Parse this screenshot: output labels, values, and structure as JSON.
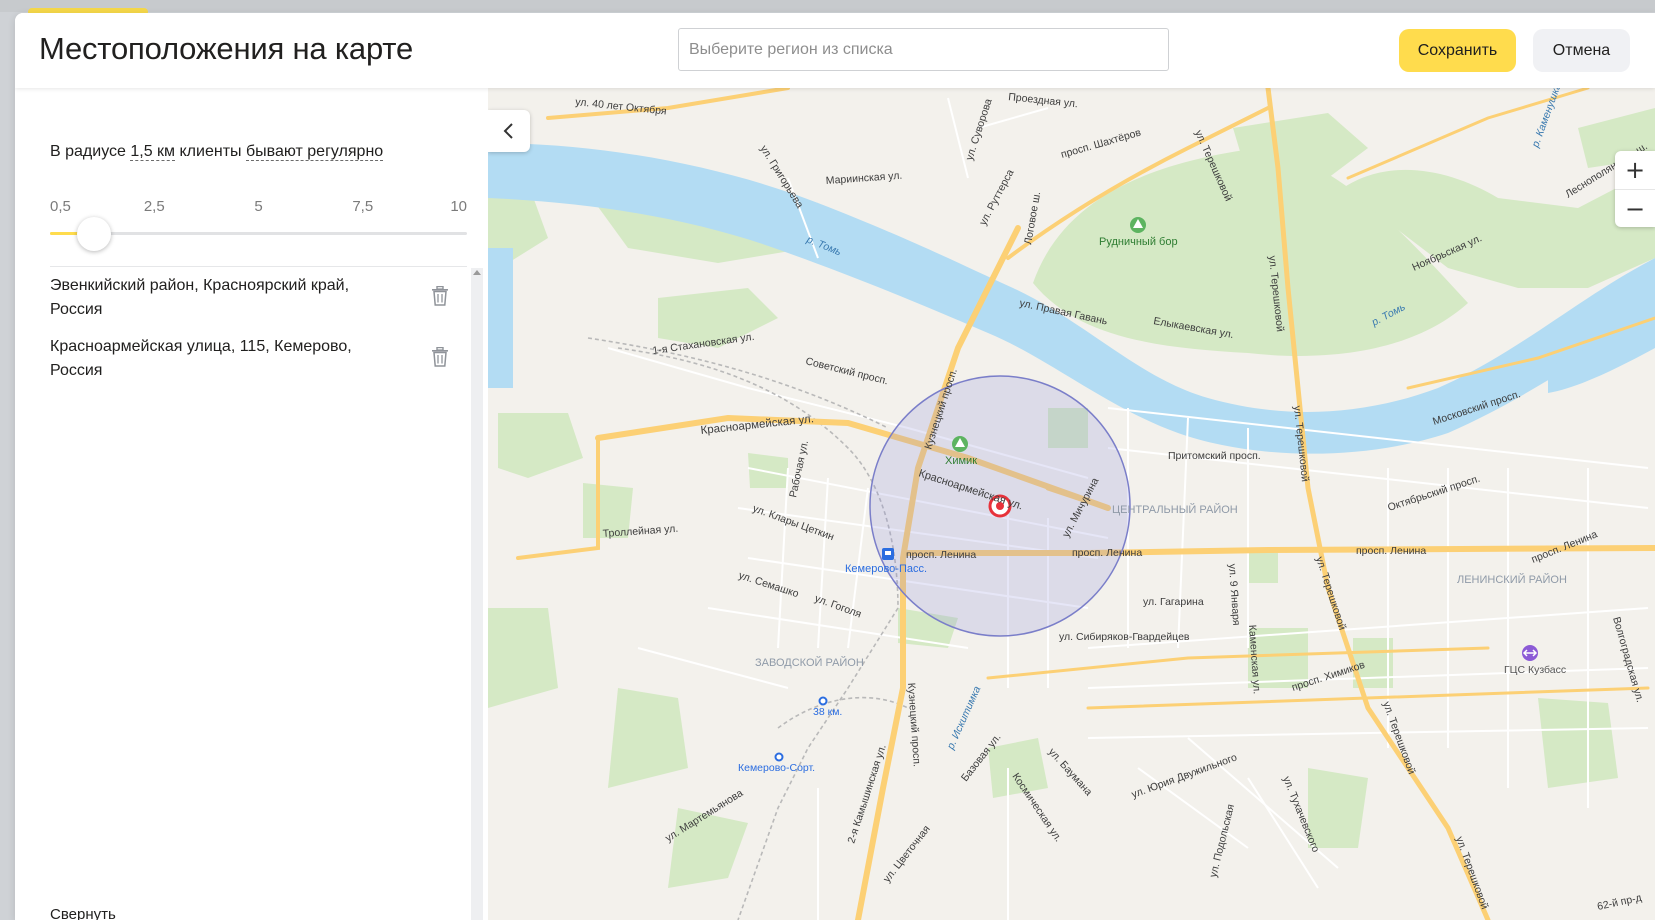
{
  "header": {
    "title": "Местоположения на карте",
    "region_placeholder": "Выберите регион из списка",
    "save_label": "Сохранить",
    "cancel_label": "Отмена"
  },
  "colors": {
    "accent_yellow": "#ffdc4d",
    "water": "#b3dcf3",
    "park": "#d5e9c5",
    "major_road": "#fcd075",
    "radius_circle": "#7a7ec9",
    "marker": "#e7323b"
  },
  "sidebar": {
    "radius": {
      "prefix": "В радиусе",
      "value": "1,5 км",
      "middle": "клиенты",
      "frequency": "бывают регулярно"
    },
    "slider": {
      "ticks": [
        "0,5",
        "2,5",
        "5",
        "7,5",
        "10"
      ],
      "min": 0.5,
      "max": 10,
      "value": 1.5
    },
    "locations": [
      {
        "text": "Эвенкийский район, Красноярский край, Россия",
        "icon": "trash-icon"
      },
      {
        "text": "Красноармейская улица, 115, Кемерово, Россия",
        "icon": "trash-icon"
      }
    ],
    "cutoff_text": "Свернуть"
  },
  "map": {
    "collapse_icon": "chevron-left-icon",
    "zoom_in": "+",
    "zoom_out": "−",
    "labels": {
      "tom_river_1": "р. Томь",
      "tom_river_2": "р. Томь",
      "rudnichny_bor": "Рудничный бор",
      "khimik": "Химик",
      "kemerovo_pass": "Кемерово-Пасс.",
      "central_district": "ЦЕНТРАЛЬНЫЙ РАЙОН",
      "zavodsky_district": "ЗАВОДСКОЙ РАЙОН",
      "leninsky_district": "ЛЕНИНСКИЙ РАЙОН",
      "gcs_kuzbass": "ГЦС Кузбасс",
      "km38": "38 км.",
      "kemerovo_sort": "Кемерово-Сорт.",
      "krasnoarmeyskaya": "Красноармейская ул.",
      "krasnoarmeyskaya_2": "Красноармейская ул.",
      "lenina_1": "просп. Ленина",
      "lenina_2": "просп. Ленина",
      "lenina_3": "просп. Ленина",
      "lenina_4": "просп. Ленина",
      "kuznetsky": "Кузнецкий просп.",
      "kuznetsky_2": "Кузнецкий просп.",
      "shakhterov": "просп. Шахтёров",
      "tereshkovoy_1": "ул. Терешковой",
      "tereshkovoy_2": "ул. Терешковой",
      "tereshkovoy_3": "ул. Терешковой",
      "tereshkovoy_4": "ул. Терешковой",
      "tereshkovoy_5": "ул. Терешковой",
      "tereshkovoy_6": "ул. Терешковой",
      "sovetsky": "Советский просп.",
      "stakhanovskaya": "1-я Стахановская ул.",
      "trolleynaya": "Троллейная ул.",
      "semashko": "ул. Семашко",
      "gogolya": "ул. Гоголя",
      "klary_tsetkin": "ул. Клары Цеткин",
      "rabochaya": "Рабочая ул.",
      "michurina": "ул. Мичурина",
      "pritomsky": "Притомский просп.",
      "gagarina": "ул. Гагарина",
      "sibiryakov": "ул. Сибиряков-Гвардейцев",
      "oktyabrsky": "Октябрьский просп.",
      "moskovsky": "Московский просп.",
      "noyabrskaya": "Ноябрьская ул.",
      "khimikov": "просп. Химиков",
      "grigorieva": "ул. Григорьева",
      "mariinskaya": "Мариинская ул.",
      "ruttera": "ул. Руттерса",
      "logovoe": "Логовое ш.",
      "pravaya_gavan": "ул. Правая Гавань",
      "elykaevskaya": "Елыкаевская ул.",
      "let40": "ул. 40 лет Октября",
      "suvorova": "ул. Суворова",
      "iskitimka": "р. Искитимка",
      "kamyshinskaya": "2-я Камышинская ул.",
      "bazovaya": "Базовая ул.",
      "kosmicheskaya": "Космическая ул.",
      "baumana": "ул. Баумана",
      "dvuzhilnogo": "ул. Юрия Двужильного",
      "yanvarya9": "ул. 9 Января",
      "kamenskaya": "Каменская ул.",
      "martemyanova": "ул. Мартемьянова",
      "tsvetochnaya": "ул. Цветочная",
      "lesnopolyanskoe": "Леснополянское ш.",
      "volgogradskaya": "Волгоградская ул.",
      "km62": "62-й пр-д",
      "kamenushka": "р. Каменушка",
      "proezdnaya": "Проездная ул.",
      "tukhachevskogo": "ул. Тухачевского",
      "podolskaya": "ул. Подольская"
    }
  }
}
